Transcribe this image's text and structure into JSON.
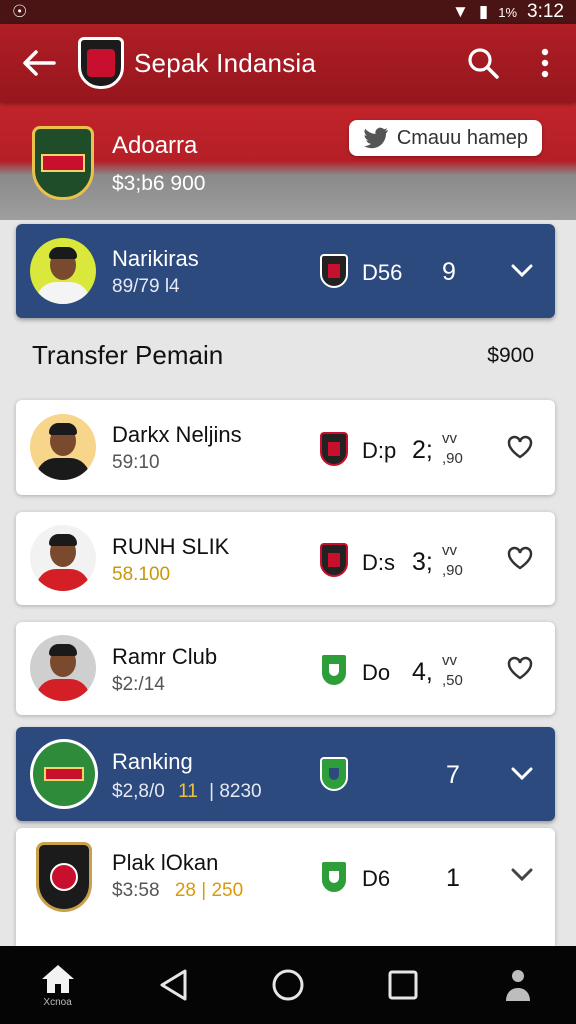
{
  "status_bar": {
    "battery": "1%",
    "time": "3:12"
  },
  "app_bar": {
    "title": "Sepak Indansia"
  },
  "team": {
    "name": "Adoarra",
    "value": "$3;b6  900",
    "share_label": "Cmauu hamep"
  },
  "featured_player": {
    "name": "Narikiras",
    "sub": "89/79 l4",
    "position": "D56",
    "number": "9"
  },
  "section": {
    "title": "Transfer Pemain",
    "value": "$900"
  },
  "transfers": [
    {
      "name": "Darkx Neljins",
      "price": "59:10",
      "position": "D:p",
      "number": "2;",
      "stat_top": "vv",
      "stat_bottom": ",90"
    },
    {
      "name": "RUNH SLIK",
      "price": "58.100",
      "position": "D:s",
      "number": "3;",
      "stat_top": "vv",
      "stat_bottom": ",90"
    },
    {
      "name": "Ramr Club",
      "price": "$2:/14",
      "position": "Do",
      "number": "4,",
      "stat_top": "vv",
      "stat_bottom": ",50"
    }
  ],
  "ranking": {
    "label": "Ranking",
    "sub_value": "$2,8/0",
    "sub_highlight": "11",
    "sub_extra": "| 8230",
    "number": "7"
  },
  "club": {
    "name": "Plak lOkan",
    "sub_value": "$3:58",
    "sub_highlight": "28 | 250",
    "position": "D6",
    "number": "1"
  },
  "nav": {
    "home_label": "Xcnoa"
  }
}
